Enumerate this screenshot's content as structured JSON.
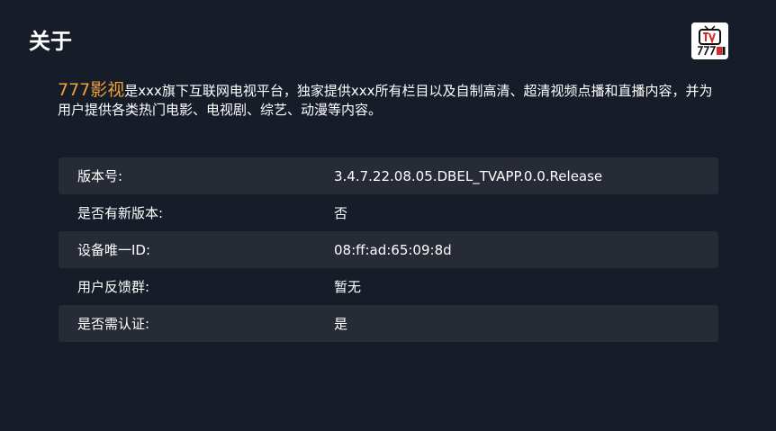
{
  "header": {
    "title": "关于",
    "logo_text": "777影视"
  },
  "intro": {
    "brand": "777影视",
    "text": "是xxx旗下互联网电视平台，独家提供xxx所有栏目以及自制高清、超清视频点播和直播内容，并为用户提供各类热门电影、电视剧、综艺、动漫等内容。"
  },
  "info": {
    "rows": [
      {
        "label": "版本号:",
        "value": "3.4.7.22.08.05.DBEL_TVAPP.0.0.Release"
      },
      {
        "label": "是否有新版本:",
        "value": "否"
      },
      {
        "label": "设备唯一ID:",
        "value": "08:ff:ad:65:09:8d"
      },
      {
        "label": "用户反馈群:",
        "value": "暂无"
      },
      {
        "label": "是否需认证:",
        "value": "是"
      }
    ]
  },
  "colors": {
    "background": "#161c28",
    "row_shaded": "#262b35",
    "brand_accent": "#f0a13a",
    "logo_red": "#d62a2a"
  },
  "icons": {
    "logo": "tv-logo-icon"
  }
}
